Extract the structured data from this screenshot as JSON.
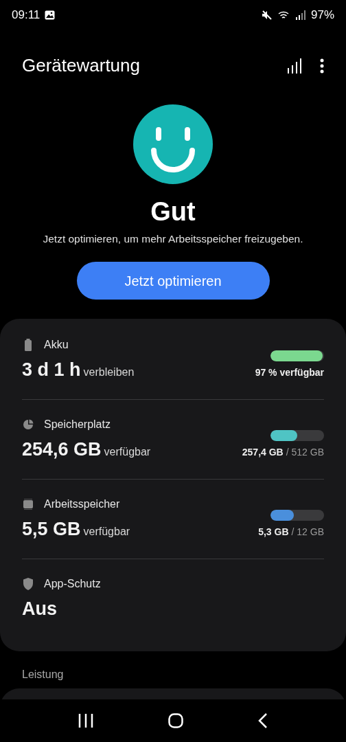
{
  "status_bar": {
    "time": "09:11",
    "battery": "97%"
  },
  "header": {
    "title": "Gerätewartung"
  },
  "hero": {
    "status": "Gut",
    "message": "Jetzt optimieren, um mehr Arbeitsspeicher freizugeben.",
    "button": "Jetzt optimieren"
  },
  "items": [
    {
      "kind": "meter",
      "label": "Akku",
      "value": "3 d 1 h",
      "unit": "verbleiben",
      "level": 0.97,
      "color": "#7bd88f",
      "reading": "97 % verfügbar"
    },
    {
      "kind": "meter",
      "label": "Speicherplatz",
      "value": "254,6 GB",
      "unit": "verfügbar",
      "level": 0.5,
      "color": "#4fc4c4",
      "reading": "257,4 GB",
      "reading_total": "/ 512 GB"
    },
    {
      "kind": "meter",
      "label": "Arbeitsspeicher",
      "value": "5,5 GB",
      "unit": "verfügbar",
      "level": 0.44,
      "color": "#4a8fdc",
      "reading": "5,3 GB",
      "reading_total": "/ 12 GB"
    },
    {
      "kind": "status",
      "label": "App-Schutz",
      "value": "Aus"
    }
  ],
  "section": {
    "title": "Leistung"
  }
}
